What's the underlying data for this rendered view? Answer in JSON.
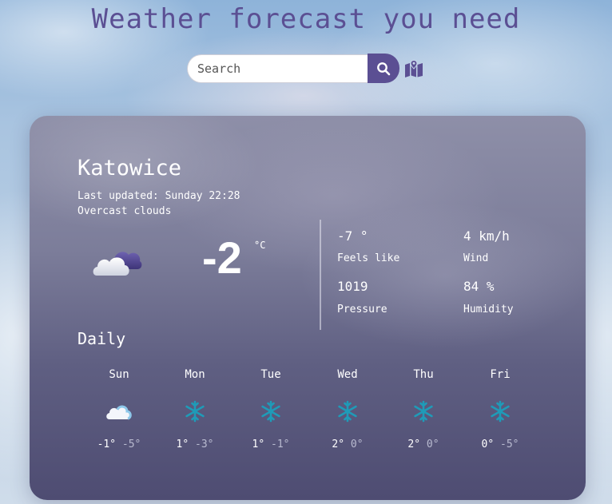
{
  "header": {
    "title": "Weather forecast you need"
  },
  "search": {
    "placeholder": "Search",
    "button_icon": "search-icon",
    "map_icon": "map-icon"
  },
  "current": {
    "city": "Katowice",
    "updated": "Last updated: Sunday 22:28",
    "description": "Overcast clouds",
    "icon": "cloud-icon",
    "temperature": "-2",
    "unit": "°C",
    "details": [
      {
        "value": "-7 °",
        "label": "Feels like"
      },
      {
        "value": "4 km/h",
        "label": "Wind"
      },
      {
        "value": "1019",
        "label": "Pressure"
      },
      {
        "value": "84 %",
        "label": "Humidity"
      }
    ]
  },
  "daily": {
    "title": "Daily",
    "days": [
      {
        "name": "Sun",
        "icon": "cloud-icon",
        "max": "-1°",
        "min": "-5°"
      },
      {
        "name": "Mon",
        "icon": "snowflake-icon",
        "max": "1°",
        "min": "-3°"
      },
      {
        "name": "Tue",
        "icon": "snowflake-icon",
        "max": "1°",
        "min": "-1°"
      },
      {
        "name": "Wed",
        "icon": "snowflake-icon",
        "max": "2°",
        "min": "0°"
      },
      {
        "name": "Thu",
        "icon": "snowflake-icon",
        "max": "2°",
        "min": "0°"
      },
      {
        "name": "Fri",
        "icon": "snowflake-icon",
        "max": "0°",
        "min": "-5°"
      }
    ]
  },
  "colors": {
    "accent": "#5b4f93",
    "snow": "#1f9bb8",
    "card_text": "#ffffff"
  }
}
